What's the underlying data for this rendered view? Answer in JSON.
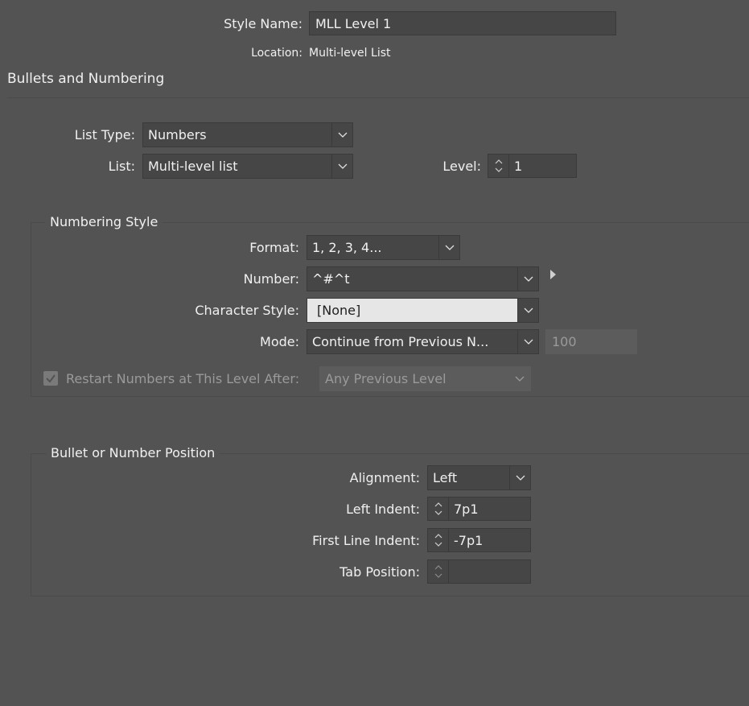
{
  "header": {
    "style_name_label": "Style Name:",
    "style_name_value": "MLL Level 1",
    "location_label": "Location:",
    "location_value": "Multi-level List"
  },
  "section_title": "Bullets and Numbering",
  "list_type": {
    "label": "List Type:",
    "value": "Numbers"
  },
  "list": {
    "label": "List:",
    "value": "Multi-level list"
  },
  "level": {
    "label": "Level:",
    "value": "1"
  },
  "numbering_style": {
    "title": "Numbering Style",
    "format": {
      "label": "Format:",
      "value": "1, 2, 3, 4..."
    },
    "number": {
      "label": "Number:",
      "value": "^#^t"
    },
    "character_style": {
      "label": "Character Style:",
      "value": "[None]"
    },
    "mode": {
      "label": "Mode:",
      "value": "Continue from Previous N...",
      "start_value": "100"
    },
    "restart": {
      "label": "Restart Numbers at This Level After:",
      "value": "Any Previous Level",
      "checked": true
    }
  },
  "position": {
    "title": "Bullet or Number Position",
    "alignment": {
      "label": "Alignment:",
      "value": "Left"
    },
    "left_indent": {
      "label": "Left Indent:",
      "value": "7p1"
    },
    "first_line_indent": {
      "label": "First Line Indent:",
      "value": "-7p1"
    },
    "tab_position": {
      "label": "Tab Position:",
      "value": ""
    }
  },
  "icons": {
    "dropdown": "chevron-down-icon",
    "spinner": "stepper-icon",
    "insert_special": "triangle-right-icon",
    "checkbox": "checkmark-icon"
  },
  "colors": {
    "panel_bg": "#535353",
    "field_bg": "#464646",
    "highlight_field_bg": "#e6e6e6",
    "disabled_text": "#9a9a9a"
  }
}
